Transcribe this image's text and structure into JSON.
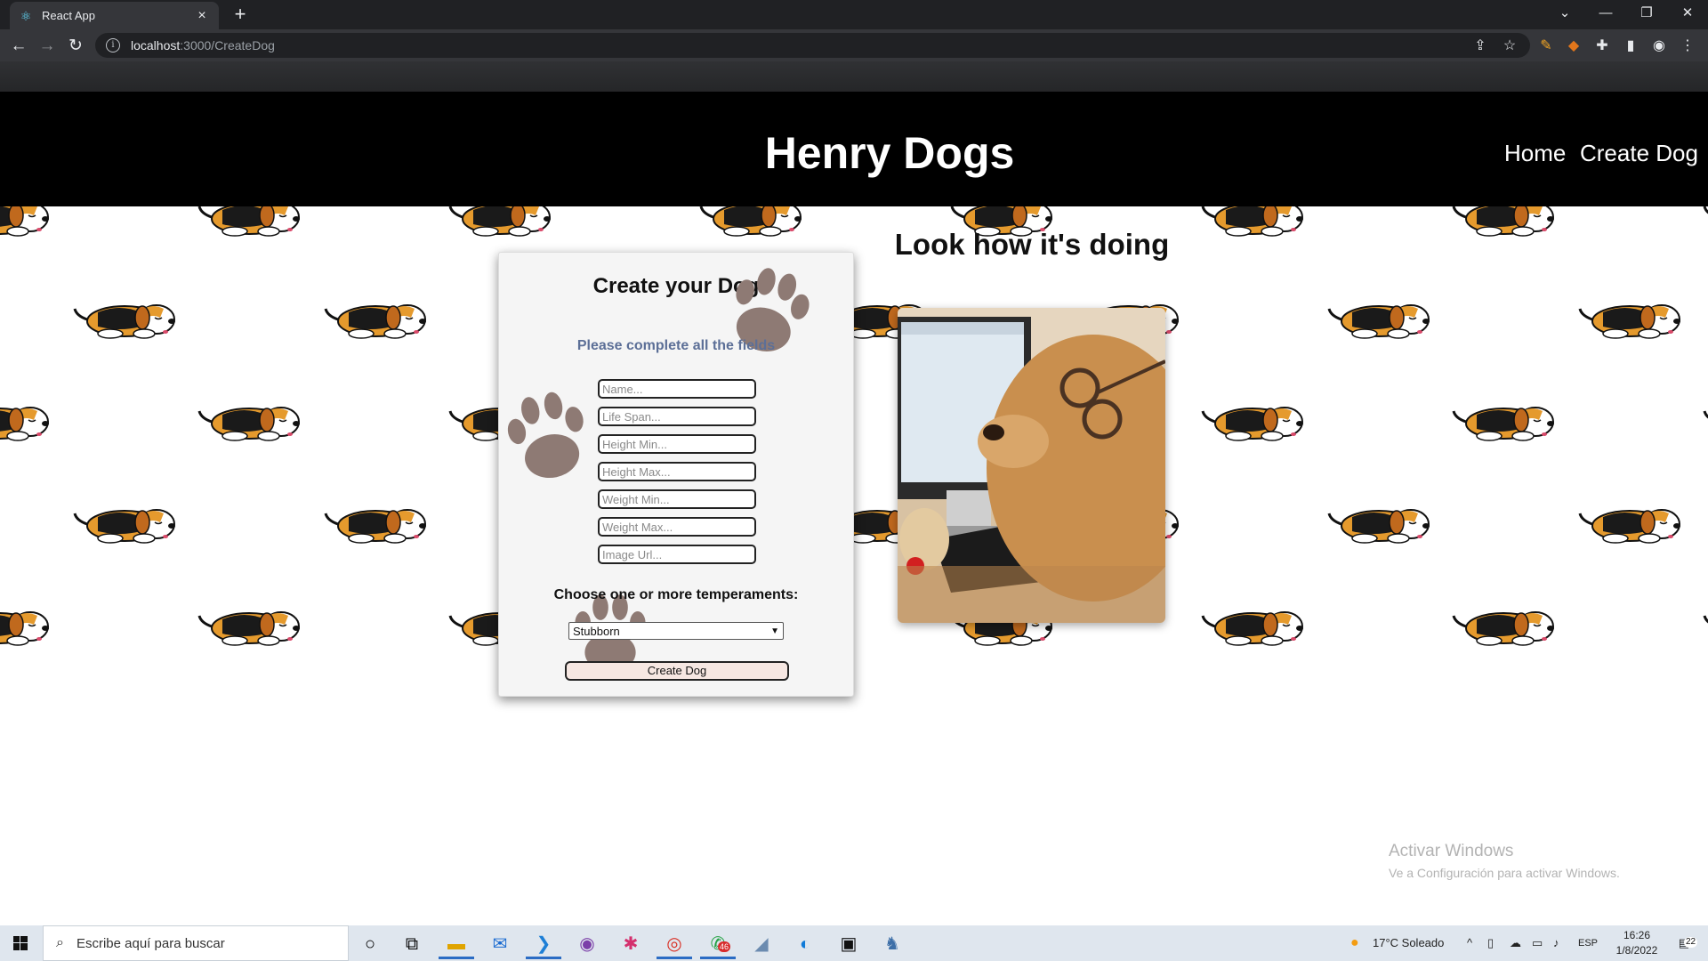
{
  "browser": {
    "tab_title": "React App",
    "url_host": "localhost",
    "url_path": ":3000/CreateDog"
  },
  "site": {
    "title": "Henry Dogs",
    "nav": [
      "Home",
      "Create Dog"
    ]
  },
  "form": {
    "title": "Create your Dog",
    "subtitle": "Please complete all the fields",
    "placeholders": {
      "name": "Name...",
      "life_span": "Life Span...",
      "height_min": "Height Min...",
      "height_max": "Height Max...",
      "weight_min": "Weight Min...",
      "weight_max": "Weight Max...",
      "image_url": "Image Url..."
    },
    "temperaments_label": "Choose one or more temperaments:",
    "temperament_selected": "Stubborn",
    "submit_label": "Create Dog"
  },
  "preview": {
    "title": "Look how it's doing"
  },
  "watermark": {
    "line1": "Activar Windows",
    "line2": "Ve a Configuración para activar Windows."
  },
  "taskbar": {
    "search_placeholder": "Escribe aquí para buscar",
    "whatsapp_badge": "46",
    "weather": "17°C  Soleado",
    "language": "ESP",
    "time": "16:26",
    "date": "1/8/2022",
    "notifications": "22"
  },
  "colors": {
    "header_bg": "#000000",
    "subtitle": "#5c6f97",
    "button_bg": "#f6e7e2",
    "paw": "#8e7a74"
  }
}
